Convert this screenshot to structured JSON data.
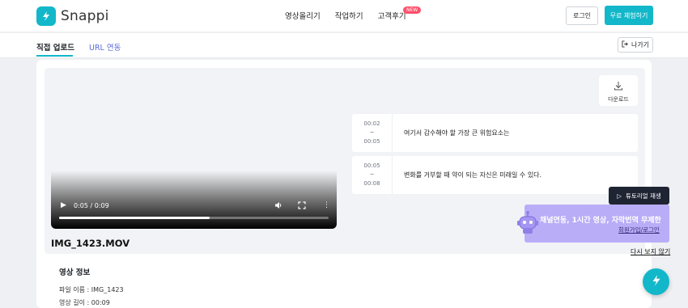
{
  "brand": {
    "name": "Snappi",
    "accent": "#12b7c9"
  },
  "nav": {
    "items": [
      "영상올리기",
      "작업하기",
      "고객후기"
    ],
    "new_badge": "NEW"
  },
  "header": {
    "login_label": "로그인",
    "trial_label": "무료 체험하기"
  },
  "tabs": {
    "direct_upload": "직접 업로드",
    "url_link": "URL 연동",
    "exit_label": "나가기"
  },
  "video": {
    "time": "0:05 / 0:09",
    "progress": 0.56,
    "filename": "IMG_1423.MOV"
  },
  "info": {
    "title": "영상 정보",
    "file_name": "파일 이름 : IMG_1423",
    "duration": "영상 길이 : 00:09"
  },
  "download_label": "다운로드",
  "subtitles": [
    {
      "start": "00:02",
      "sep": "~",
      "end": "00:05",
      "text": "여기서 감수해야 할 가장 큰 위험요소는"
    },
    {
      "start": "00:05",
      "sep": "~",
      "end": "00:08",
      "text": "변화를 거부할 때 약이 되는 자신은 미래일 수 있다."
    }
  ],
  "promo": {
    "tutorial_label": "튜토리얼 재생",
    "title": "채널연동, 1시간 영상, 자막번역 무제한",
    "link": "회원가입/로그인",
    "dismiss": "다시 보지 않기",
    "color": "#b9adf7"
  },
  "icons": [
    "logo-icon",
    "exit-icon",
    "download-icon",
    "play-icon",
    "volume-icon",
    "fullscreen-icon",
    "more-icon",
    "robot-icon",
    "chat-icon"
  ]
}
